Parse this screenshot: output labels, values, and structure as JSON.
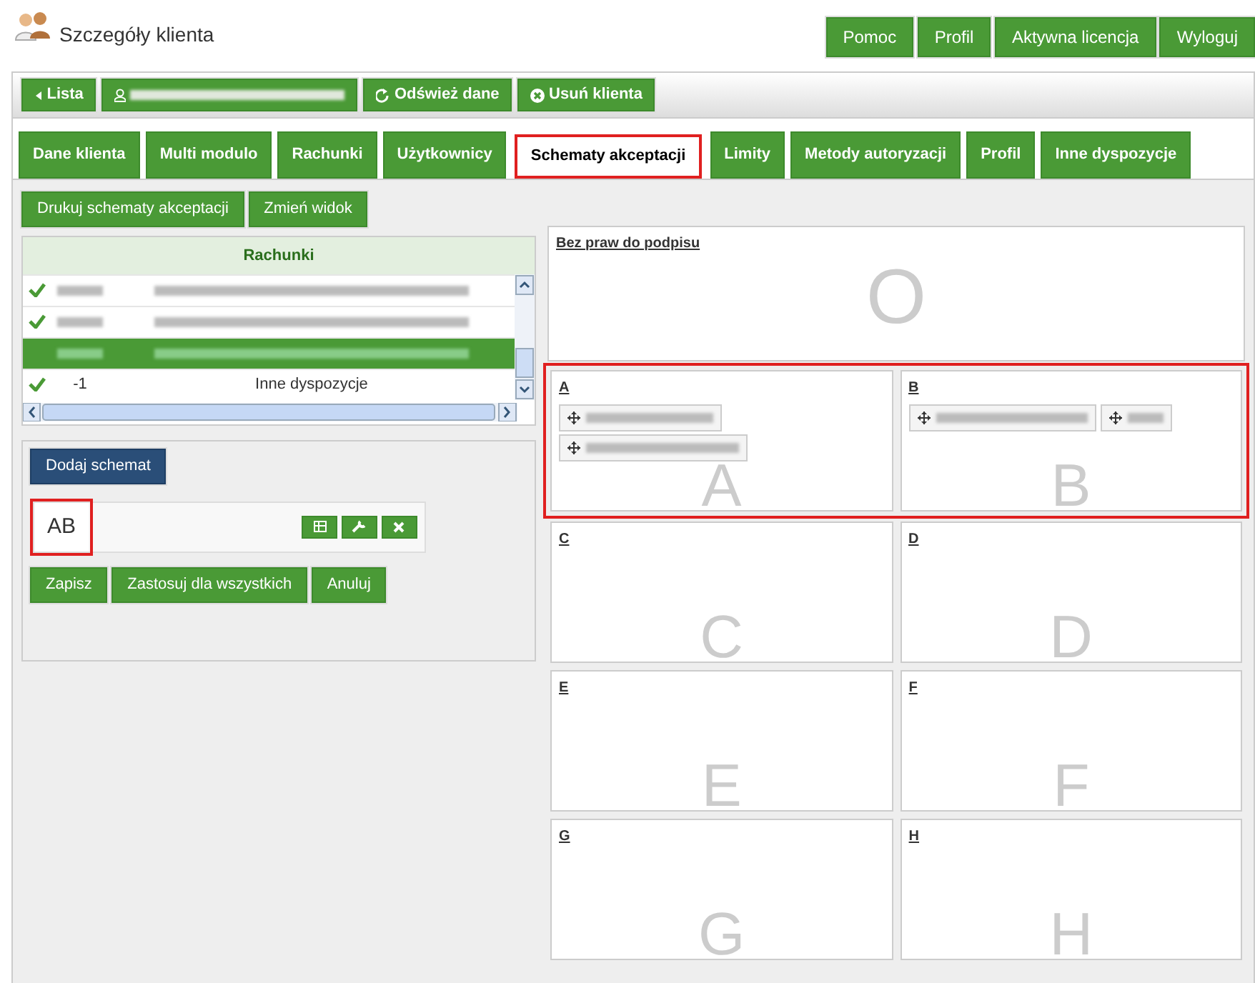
{
  "header": {
    "title": "Szczegóły klienta",
    "buttons": [
      "Pomoc",
      "Profil",
      "Aktywna licencja",
      "Wyloguj"
    ]
  },
  "toolbar": [
    {
      "kind": "back",
      "label": "Lista"
    },
    {
      "kind": "client"
    },
    {
      "kind": "refresh",
      "label": "Odśwież dane"
    },
    {
      "kind": "delete",
      "label": "Usuń klienta"
    }
  ],
  "tabs": [
    {
      "label": "Dane klienta",
      "selected": false
    },
    {
      "label": "Multi modulo",
      "selected": false
    },
    {
      "label": "Rachunki",
      "selected": false
    },
    {
      "label": "Użytkownicy",
      "selected": false
    },
    {
      "label": "Schematy akceptacji",
      "selected": true
    },
    {
      "label": "Limity",
      "selected": false
    },
    {
      "label": "Metody autoryzacji",
      "selected": false
    },
    {
      "label": "Profil",
      "selected": false
    },
    {
      "label": "Inne dyspozycje",
      "selected": false
    }
  ],
  "actions": [
    "Drukuj schematy akceptacji",
    "Zmień widok"
  ],
  "accounts": {
    "title": "Rachunki",
    "rows": [
      {
        "checked": true,
        "selected": false,
        "redacted": true
      },
      {
        "checked": true,
        "selected": false,
        "redacted": true
      },
      {
        "checked": false,
        "selected": true,
        "redacted": true
      },
      {
        "checked": true,
        "selected": false,
        "redacted": false,
        "number": "-1",
        "name": "Inne dyspozycje"
      }
    ]
  },
  "schema_panel": {
    "add_button": "Dodaj schemat",
    "schema": {
      "name": "AB",
      "highlighted": true
    },
    "buttons": [
      "Zapisz",
      "Zastosuj dla wszystkich",
      "Anuluj"
    ]
  },
  "unsigned": {
    "label": "Bez praw do podpisu",
    "letter": "O"
  },
  "group_rows": [
    {
      "highlighted": true,
      "groups": [
        {
          "label": "A",
          "letter": "A",
          "chips": [
            {
              "kind": "redacted"
            },
            {
              "kind": "redacted"
            }
          ]
        },
        {
          "label": "B",
          "letter": "B",
          "chips": [
            {
              "kind": "redacted"
            },
            {
              "kind": "redacted"
            }
          ]
        }
      ]
    },
    {
      "highlighted": false,
      "groups": [
        {
          "label": "C",
          "letter": "C"
        },
        {
          "label": "D",
          "letter": "D"
        }
      ]
    },
    {
      "highlighted": false,
      "groups": [
        {
          "label": "E",
          "letter": "E"
        },
        {
          "label": "F",
          "letter": "F"
        }
      ]
    },
    {
      "highlighted": false,
      "groups": [
        {
          "label": "G",
          "letter": "G"
        },
        {
          "label": "H",
          "letter": "H"
        }
      ]
    }
  ]
}
